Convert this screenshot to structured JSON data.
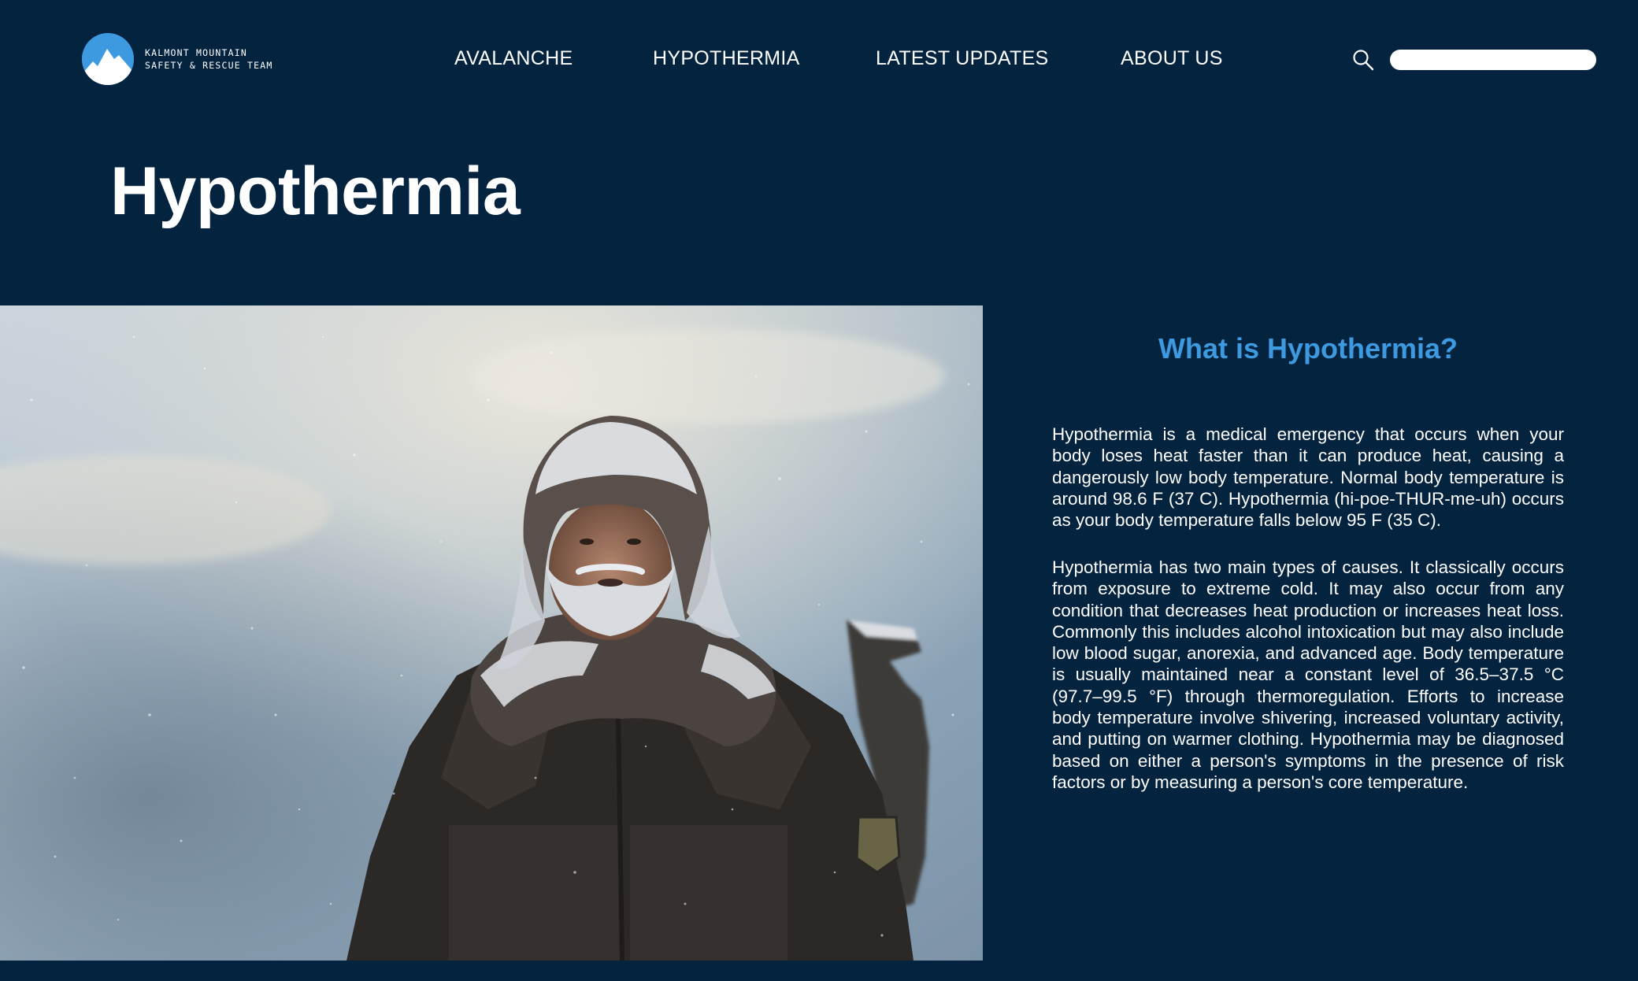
{
  "brand": {
    "name_line1": "KALMONT MOUNTAIN",
    "name_line2": "SAFETY & RESCUE TEAM",
    "logo_icon": "mountain-logo-icon",
    "accent_color": "#3d9ae0",
    "background_color": "#04233f"
  },
  "nav": {
    "items": [
      {
        "label": "AVALANCHE"
      },
      {
        "label": "HYPOTHERMIA"
      },
      {
        "label": "LATEST UPDATES"
      },
      {
        "label": "ABOUT US"
      }
    ]
  },
  "search": {
    "icon": "search-icon",
    "value": "",
    "placeholder": ""
  },
  "page": {
    "title": "Hypothermia"
  },
  "hero": {
    "icon": "hero-photo"
  },
  "info": {
    "heading": "What is Hypothermia?",
    "paragraphs": [
      "Hypothermia is a medical emergency that occurs when your body loses heat faster than it can produce heat, causing a dangerously low body temperature. Normal body temperature is around 98.6 F (37 C). Hypothermia (hi-poe-THUR-me-uh) occurs as your body temperature falls below 95 F (35 C).",
      "Hypothermia has two main types of causes. It classically occurs from exposure to extreme cold. It may also occur from any condition that decreases heat production or increases heat loss. Commonly this includes alcohol intoxication but may also include low blood sugar, anorexia, and advanced age. Body temperature is usually maintained near a constant level of 36.5–37.5 °C (97.7–99.5 °F) through thermoregulation. Efforts to increase body temperature involve shivering, increased voluntary activity, and putting on warmer clothing. Hypothermia may be diagnosed based on either a person's symptoms in the presence of risk factors or by measuring a person's core temperature."
    ]
  }
}
